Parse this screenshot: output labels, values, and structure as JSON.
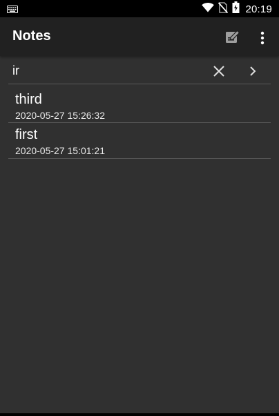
{
  "status_bar": {
    "time": "20:19",
    "icons": [
      "keyboard-icon",
      "wifi-icon",
      "no-sim-icon",
      "battery-icon"
    ]
  },
  "app_bar": {
    "title": "Notes",
    "actions": [
      "edit-note-icon",
      "more-vert-icon"
    ]
  },
  "search": {
    "value": "ir",
    "icons": [
      "close-icon",
      "chevron-right-icon"
    ]
  },
  "notes": [
    {
      "title": "third",
      "date": "2020-05-27 15:26:32"
    },
    {
      "title": "first",
      "date": "2020-05-27 15:01:21"
    }
  ],
  "colors": {
    "background": "#303030",
    "app_bar": "#212121",
    "status_bar": "#000000",
    "divider": "#5a5a5a",
    "text": "#ffffff"
  }
}
